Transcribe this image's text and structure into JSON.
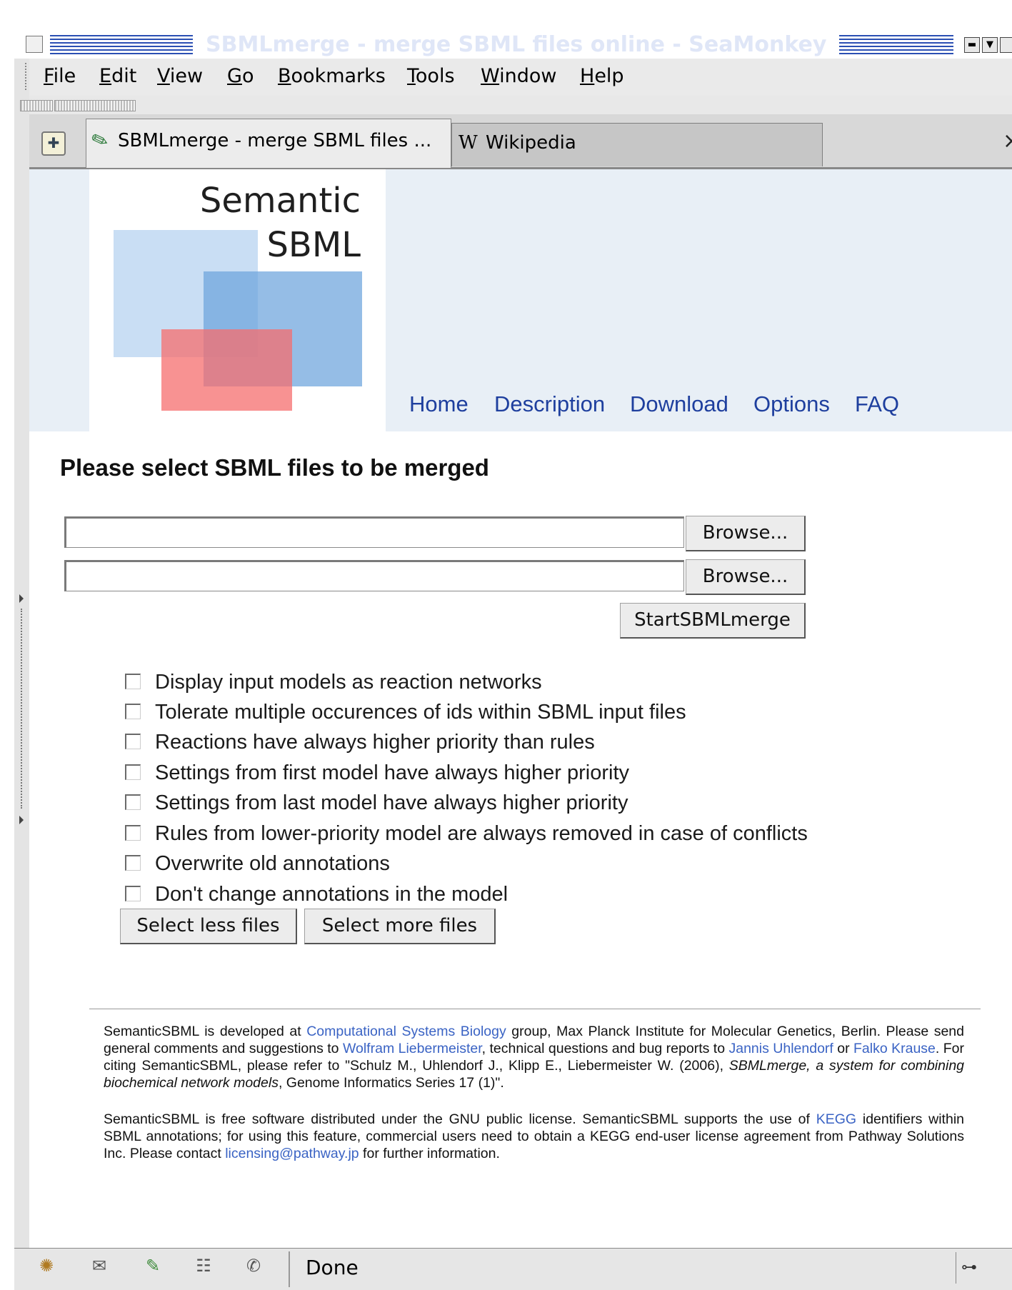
{
  "window": {
    "title": "SBMLmerge - merge SBML files online - SeaMonkey"
  },
  "menubar": [
    {
      "label": "File",
      "mnemonic": "F",
      "rest": "ile"
    },
    {
      "label": "Edit",
      "mnemonic": "E",
      "rest": "dit"
    },
    {
      "label": "View",
      "mnemonic": "V",
      "rest": "iew"
    },
    {
      "label": "Go",
      "mnemonic": "G",
      "rest": "o"
    },
    {
      "label": "Bookmarks",
      "mnemonic": "B",
      "rest": "ookmarks"
    },
    {
      "label": "Tools",
      "mnemonic": "T",
      "rest": "ools"
    },
    {
      "label": "Window",
      "mnemonic": "W",
      "rest": "indow"
    },
    {
      "label": "Help",
      "mnemonic": "H",
      "rest": "elp"
    }
  ],
  "tabs": [
    {
      "label": "SBMLmerge - merge SBML files ...",
      "icon": "pen-icon",
      "active": true
    },
    {
      "label": "Wikipedia",
      "icon": "wikipedia-w-icon",
      "active": false
    }
  ],
  "tabbar": {
    "close_glyph": "×"
  },
  "logo": {
    "line1": "Semantic",
    "line2": "SBML"
  },
  "nav": [
    "Home",
    "Description",
    "Download",
    "Options",
    "FAQ"
  ],
  "main": {
    "title": "Please select SBML files to be merged",
    "file_inputs": [
      {
        "value": "",
        "button": "Browse..."
      },
      {
        "value": "",
        "button": "Browse..."
      }
    ],
    "submit_label": "StartSBMLmerge",
    "options": [
      {
        "label": "Display input models as reaction networks",
        "checked": false
      },
      {
        "label": "Tolerate multiple occurences of ids within SBML input files",
        "checked": false
      },
      {
        "label": "Reactions have always higher priority than rules",
        "checked": false
      },
      {
        "label": "Settings from first model have always higher priority",
        "checked": false
      },
      {
        "label": "Settings from last model have always higher priority",
        "checked": false
      },
      {
        "label": "Rules from lower-priority model are always removed in case of conflicts",
        "checked": false
      },
      {
        "label": "Overwrite old annotations",
        "checked": false
      },
      {
        "label": "Don't change annotations in the model",
        "checked": false
      }
    ],
    "less_files_label": "Select less files",
    "more_files_label": "Select more files"
  },
  "footer": {
    "p1_a": "SemanticSBML is developed at ",
    "p1_link1": "Computational Systems Biology",
    "p1_b": " group, Max Planck Institute for Molecular Genetics, Berlin. Please send general comments and suggestions to ",
    "p1_link2": "Wolfram Liebermeister",
    "p1_c": ", technical questions and bug reports to ",
    "p1_link3": "Jannis Uhlendorf",
    "p1_d": " or ",
    "p1_link4": "Falko Krause",
    "p1_e": ". For citing SemanticSBML, please refer to \"Schulz M., Uhlendorf J., Klipp E., Liebermeister W. (2006), ",
    "p1_italic": "SBMLmerge, a system for combining biochemical network models",
    "p1_f": ", Genome Informatics Series 17 (1)\".",
    "p2_a": "SemanticSBML is free software distributed under the GNU public license. SemanticSBML supports the use of ",
    "p2_link1": "KEGG",
    "p2_b": " identifiers within SBML annotations; for using this feature, commercial users need to obtain a KEGG end-user license agreement from Pathway Solutions Inc. Please contact ",
    "p2_link2": "licensing@pathway.jp",
    "p2_c": " for further information."
  },
  "statusbar": {
    "text": "Done",
    "icons": [
      "navigator-icon",
      "mail-icon",
      "composer-icon",
      "addressbook-icon",
      "irc-icon"
    ]
  },
  "colors": {
    "nav_link": "#1e3f9e",
    "footer_link": "#3a63c4",
    "header_band": "#e8eff6",
    "title_stripe": "#2b4fb3"
  }
}
